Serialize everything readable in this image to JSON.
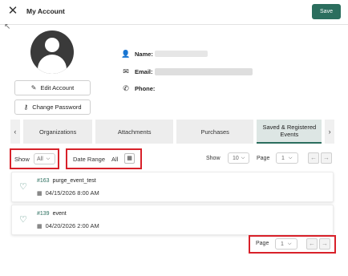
{
  "header": {
    "title": "My Account",
    "save_label": "Save",
    "close_icon": "close-icon"
  },
  "profile": {
    "edit_label": "Edit Account",
    "password_label": "Change Password",
    "name_label": "Name:",
    "email_label": "Email:",
    "phone_label": "Phone:"
  },
  "tabs": [
    {
      "label": "Organizations"
    },
    {
      "label": "Attachments"
    },
    {
      "label": "Purchases"
    },
    {
      "label": "Saved & Registered Events",
      "active": true
    }
  ],
  "filters": {
    "show_label": "Show",
    "show_value": "All",
    "date_label": "Date Range",
    "date_value": "All",
    "page_size_label": "Show",
    "page_size_value": "10",
    "page_label": "Page",
    "page_value": "1"
  },
  "events": [
    {
      "id": "#163",
      "name": "purge_event_test",
      "date": "04/15/2026 8:00 AM"
    },
    {
      "id": "#139",
      "name": "event",
      "date": "04/20/2026 2:00 AM"
    }
  ],
  "footer": {
    "page_label": "Page",
    "page_value": "1"
  },
  "colors": {
    "accent": "#2b6e5e",
    "highlight_box": "#d8212a"
  }
}
